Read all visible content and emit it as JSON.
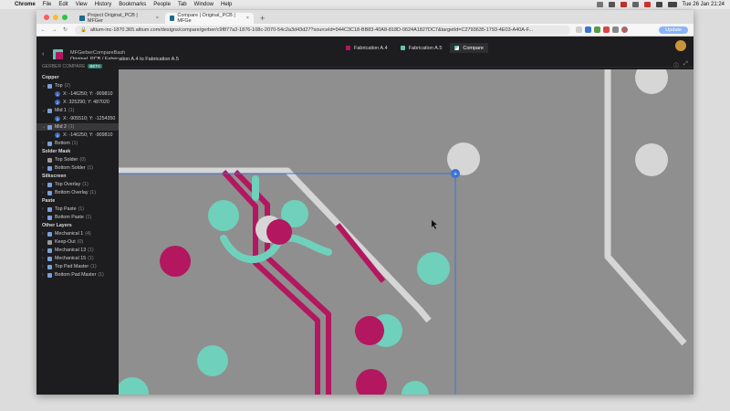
{
  "menubar": {
    "items": [
      "Chrome",
      "File",
      "Edit",
      "View",
      "History",
      "Bookmarks",
      "People",
      "Tab",
      "Window",
      "Help"
    ],
    "clock": "Tue 26 Jan  21:24"
  },
  "browser": {
    "tabs": [
      {
        "label": "Project Original_PCB | MFGer",
        "active": false
      },
      {
        "label": "Compare | Original_PCB | MFGe",
        "active": true
      }
    ],
    "new_tab": "+",
    "url": "altium-inc-1870.365.altium.com/designs/compare/gerber/c9f877a2-1876-108c-2070-54c2a3d43d27?sourceId=944C3C18-BB83-40A8-818D-0624A1827DC7&targetId=C2793635-1793-4E03-A40A-F...",
    "update_label": "Update"
  },
  "app": {
    "back": "‹",
    "crumb_top": "MFGerberCompareBash",
    "crumb_bottom": "Original_PCB / Fabrication A.4 to Fabrication A.5",
    "compare_tabs": [
      {
        "label": "Fabrication A.4",
        "color": "#b3175f"
      },
      {
        "label": "Fabrication A.5",
        "color": "#5fc7b2"
      },
      {
        "label": "Compare",
        "color": "#5fc7b2"
      }
    ],
    "info_icon": "ⓘ",
    "expand_icon": "⤢"
  },
  "sidebar": {
    "title": "GERBER COMPARE",
    "beta": "BETA",
    "sections": [
      {
        "name": "Copper"
      },
      {
        "name": "Solder Mask"
      },
      {
        "name": "Silkscreen"
      },
      {
        "name": "Paste"
      },
      {
        "name": "Other Layers"
      }
    ],
    "layers": [
      {
        "label": "Top",
        "count": "(2)"
      },
      {
        "num": "1",
        "label": "X: -146250; Y: -909810"
      },
      {
        "num": "2",
        "label": "X: 325290; Y: 487020"
      },
      {
        "label": "Mid 1",
        "count": "(1)"
      },
      {
        "num": "3",
        "label": "X: -905510; Y: -1254350"
      },
      {
        "label": "Mid 2",
        "count": "(1)"
      },
      {
        "num": "4",
        "label": "X: -146250; Y: -909810"
      },
      {
        "label": "Bottom",
        "count": "(1)"
      },
      {
        "label": "Top Solder",
        "count": "(0)"
      },
      {
        "label": "Bottom Solder",
        "count": "(1)"
      },
      {
        "label": "Top Overlay",
        "count": "(1)"
      },
      {
        "label": "Bottom Overlay",
        "count": "(1)"
      },
      {
        "label": "Top Paste",
        "count": "(1)"
      },
      {
        "label": "Bottom Paste",
        "count": "(1)"
      },
      {
        "label": "Mechanical 1",
        "count": "(4)"
      },
      {
        "label": "Keep-Out",
        "count": "(0)"
      },
      {
        "label": "Mechanical 13",
        "count": "(1)"
      },
      {
        "label": "Mechanical 15",
        "count": "(1)"
      },
      {
        "label": "Top Pad Master",
        "count": "(1)"
      },
      {
        "label": "Bottom Pad Master",
        "count": "(1)"
      }
    ]
  },
  "canvas": {
    "marker": "+"
  },
  "colors": {
    "magenta": "#b3175f",
    "teal": "#6fd0bb",
    "silk": "#d6d6d6",
    "board": "#8f8f8f",
    "selection": "#3b74d4"
  }
}
